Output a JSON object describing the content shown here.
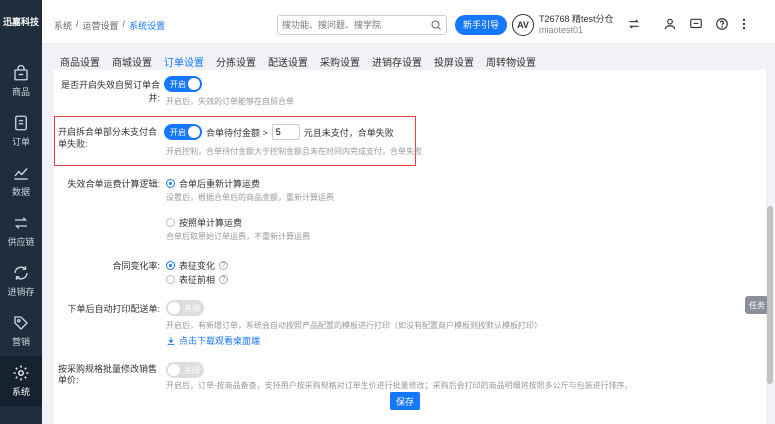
{
  "sidebar": {
    "logo": "迅嘉科技",
    "items": [
      {
        "label": "商品",
        "icon": "shopping-bag-icon"
      },
      {
        "label": "订单",
        "icon": "order-list-icon"
      },
      {
        "label": "数据",
        "icon": "chart-line-icon"
      },
      {
        "label": "供应链",
        "icon": "exchange-icon"
      },
      {
        "label": "进销存",
        "icon": "cycle-icon"
      },
      {
        "label": "营销",
        "icon": "tag-icon"
      },
      {
        "label": "系统",
        "icon": "gear-icon"
      }
    ]
  },
  "header": {
    "breadcrumb": [
      "系统",
      "/",
      "运营设置",
      "/",
      "系统设置"
    ],
    "search_placeholder": "搜功能、搜问题、搜学院",
    "guide_button": "新手引导",
    "avatar_text": "AV",
    "account_name": "T26768 精test分仓",
    "account_sub": "miaotest01"
  },
  "tabs": [
    "商品设置",
    "商城设置",
    "订单设置",
    "分拣设置",
    "配送设置",
    "采购设置",
    "进销存设置",
    "投屏设置",
    "周转物设置"
  ],
  "settings": {
    "merge_unpaid": {
      "label": "是否开启失效自贸订单合并:",
      "switch": "开启",
      "desc": "开启后，失效的订单能够在自贸合单"
    },
    "partial_pay": {
      "label": "开启拆合单部分未支付合单失败:",
      "switch": "开启",
      "pre": "合单待付金额 >",
      "value": "5",
      "post": "元且未支付，合单失败",
      "desc": "开启控制，合单待付金额大于控制金额且未在时间内完成支付，合单失败"
    },
    "freight": {
      "label": "失效合单运费计算逻辑:",
      "opt1": "合单后重新计算运费",
      "opt1_desc": "设置后，根据合单后的商品金额，重新计算运费",
      "opt2": "按照单计算运费",
      "opt2_desc": "合单后取原始订单运费，不重新计算运费"
    },
    "merge_change": {
      "label": "合同变化率:",
      "opt1": "表征变化",
      "opt2": "表征前相"
    },
    "auto_print": {
      "label": "下单后自动打印配送单:",
      "switch": "关闭",
      "desc": "开启后，有新增订单，系统会自动按照产品配置的模板进行打印（如没有配置商户模板则按默认模板打印）",
      "link": "点击下载观看桌面端"
    },
    "purchase_spec": {
      "label": "按采购规格批量修改销售单价:",
      "switch": "关闭",
      "desc": "开启后，订单-按商品备查，支持用户按采购规格对订单生价进行批量修改；采购后会打印的商品明细将按照多公斤与包装进行排序。"
    }
  },
  "save_button": "保存",
  "float_tab": "任务"
}
